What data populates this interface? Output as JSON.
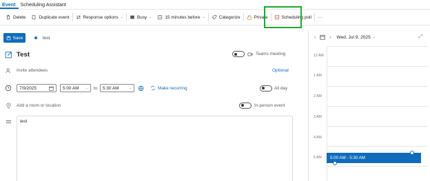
{
  "tabs": [
    {
      "label": "Event"
    },
    {
      "label": "Scheduling Assistant"
    }
  ],
  "toolbar": {
    "delete": "Delete",
    "duplicate": "Duplicate event",
    "response_options": "Response options",
    "busy": "Busy",
    "reminder": "15 minutes before",
    "categorize": "Categorize",
    "private": "Private",
    "scheduling_poll": "Scheduling poll",
    "more": "···"
  },
  "save": {
    "button": "Save",
    "event_title": "test"
  },
  "form": {
    "title": "Test",
    "teams_meeting": "Teams meeting",
    "attendees_placeholder": "Invite attendees",
    "optional": "Optional",
    "start_date": "7/9/2025",
    "start_time": "5:00 AM",
    "to": "to",
    "end_time": "5:30 AM",
    "make_recurring": "Make recurring",
    "all_day": "All day",
    "location_placeholder": "Add a room or location",
    "in_person": "In-person event",
    "body": "test"
  },
  "calendar": {
    "date": "Wed, Jul 9, 2025",
    "hours": [
      "12 AM",
      "1 AM",
      "2 AM",
      "3 AM",
      "4 AM",
      "5 AM"
    ],
    "event_label": "5:00 AM - 5:30 AM"
  },
  "colors": {
    "accent": "#0f6cbd",
    "highlight": "#1aab2a"
  }
}
